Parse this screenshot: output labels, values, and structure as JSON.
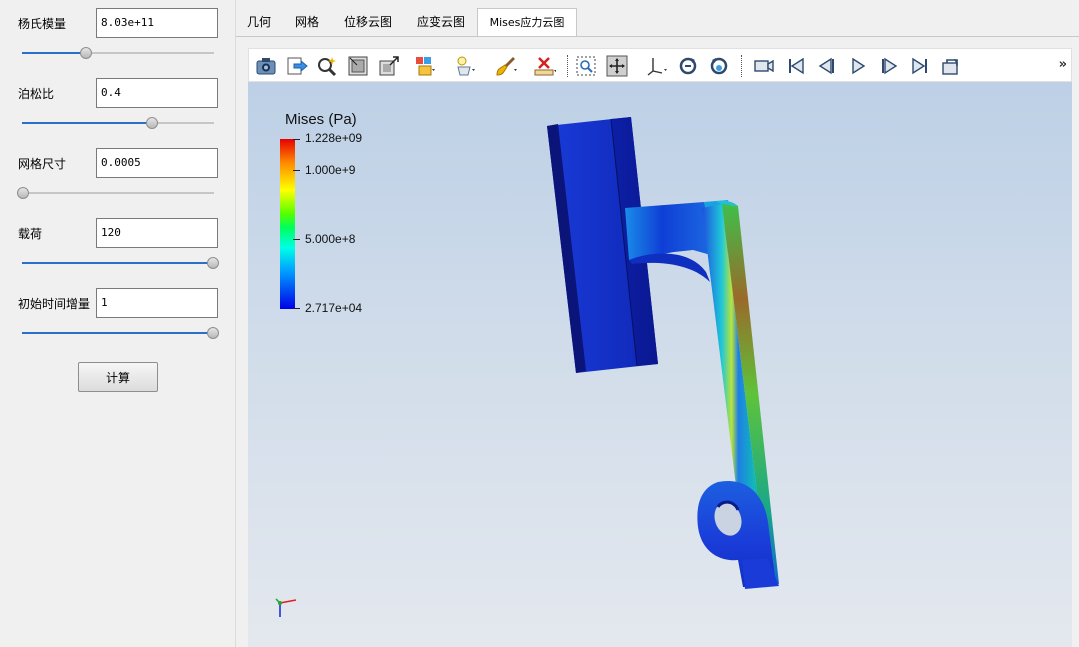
{
  "params": [
    {
      "label": "杨氏模量",
      "value": "8.03e+11",
      "slider": 0.33
    },
    {
      "label": "泊松比",
      "value": "0.4",
      "slider": 0.68
    },
    {
      "label": "网格尺寸",
      "value": "0.0005",
      "slider": 0.0
    },
    {
      "label": "载荷",
      "value": "120",
      "slider": 1.0
    },
    {
      "label": "初始时间增量",
      "value": "1",
      "slider": 1.0
    }
  ],
  "calc_button": "计算",
  "tabs": [
    "几何",
    "网格",
    "位移云图",
    "应变云图",
    "Mises应力云图"
  ],
  "active_tab": "Mises应力云图",
  "toolbar": {
    "icons": [
      "camera-icon",
      "export-icon",
      "zoom-magic-icon",
      "fit-view-icon",
      "maximize-icon",
      "display-mode-icon",
      "lighting-icon",
      "brush-icon",
      "measure-icon",
      "zoom-box-icon",
      "pan-icon",
      "axes-icon",
      "rotate-cw-icon",
      "rotate-ccw-icon",
      "video-camera-icon",
      "first-frame-icon",
      "prev-frame-icon",
      "play-icon",
      "next-frame-icon",
      "last-frame-icon",
      "loop-icon"
    ],
    "more": "»"
  },
  "legend": {
    "title": "Mises (Pa)",
    "max_label": "1.228e+09",
    "labels": [
      "1.228e+09",
      "1.000e+9",
      "5.000e+8",
      "2.717e+04"
    ],
    "min": 27170,
    "max": 1228000000
  },
  "colors": {
    "accent": "#2a6fc9",
    "high": "#e60000",
    "low": "#0000e6"
  }
}
